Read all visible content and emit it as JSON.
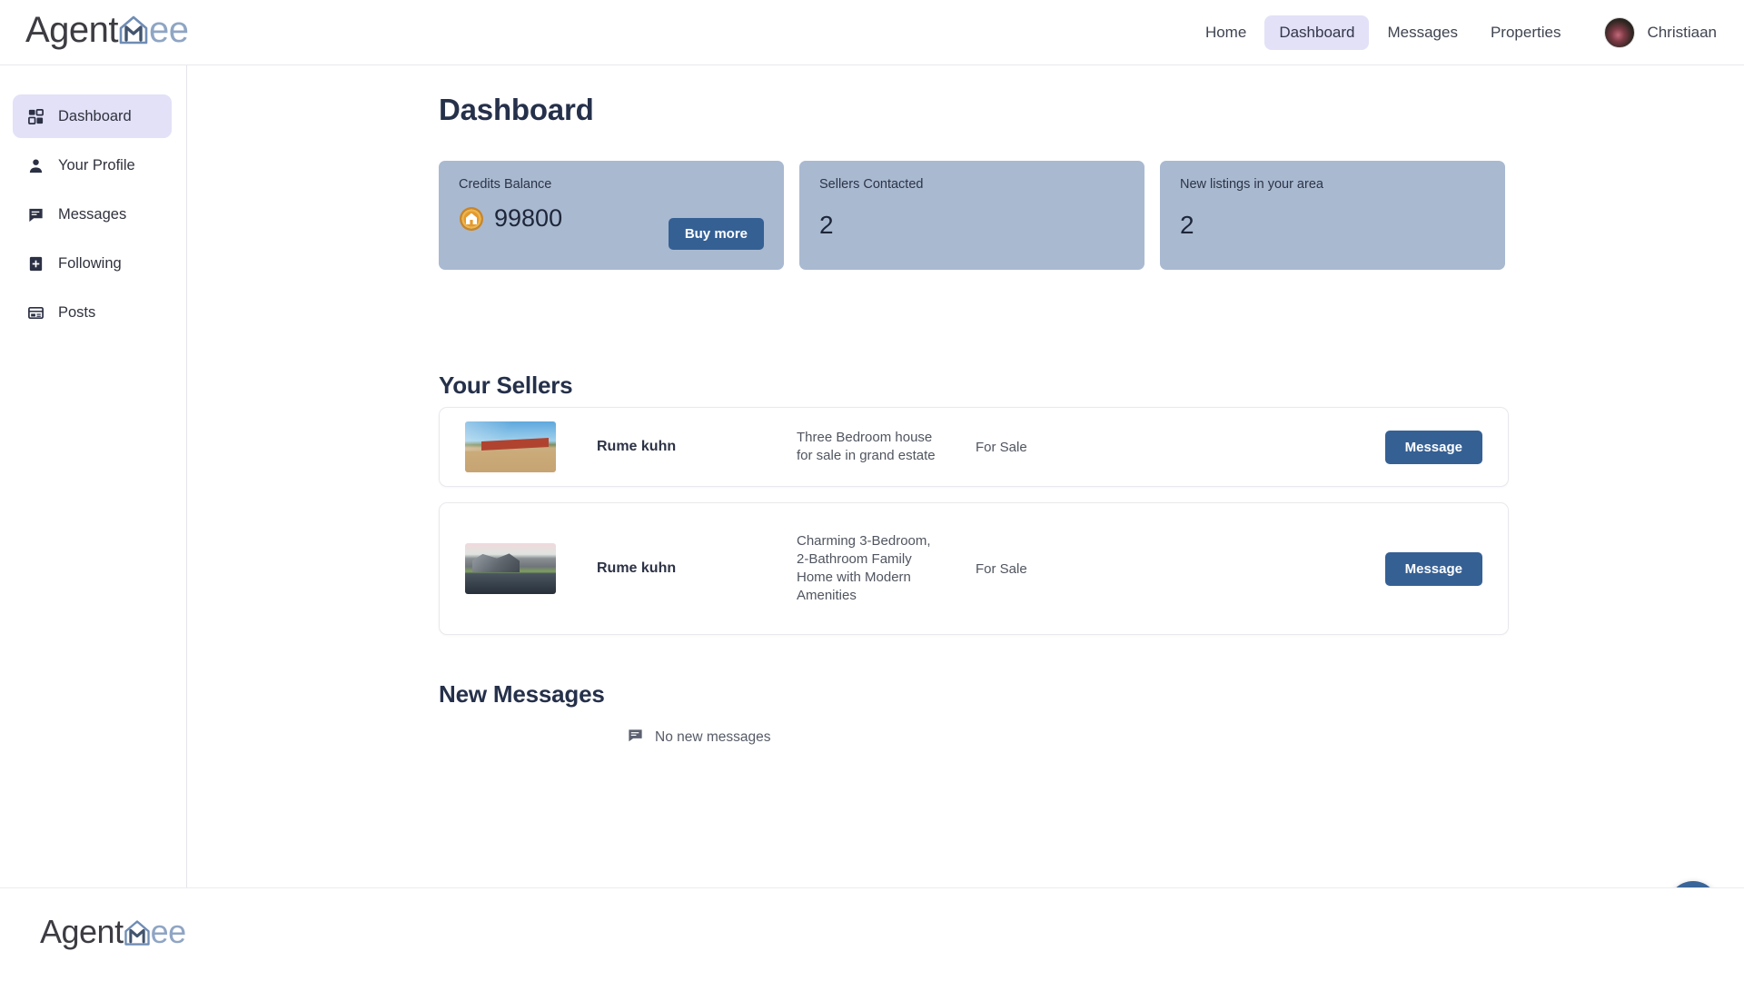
{
  "brand": {
    "prefix": "Agent",
    "mark": "house-m-logo",
    "suffix": "ee"
  },
  "topnav": {
    "links": [
      {
        "label": "Home",
        "name": "nav-home",
        "active": false
      },
      {
        "label": "Dashboard",
        "name": "nav-dashboard",
        "active": true
      },
      {
        "label": "Messages",
        "name": "nav-messages",
        "active": false
      },
      {
        "label": "Properties",
        "name": "nav-properties",
        "active": false
      }
    ],
    "user": {
      "name": "Christiaan",
      "avatar_icon": "user-avatar-photo"
    }
  },
  "sidebar": {
    "items": [
      {
        "label": "Dashboard",
        "icon": "grid-dashboard-icon",
        "active": true
      },
      {
        "label": "Your Profile",
        "icon": "person-icon",
        "active": false
      },
      {
        "label": "Messages",
        "icon": "chat-bubble-icon",
        "active": false
      },
      {
        "label": "Following",
        "icon": "bookmark-plus-icon",
        "active": false
      },
      {
        "label": "Posts",
        "icon": "article-icon",
        "active": false
      }
    ]
  },
  "main": {
    "page_title": "Dashboard",
    "cards": [
      {
        "label": "Credits Balance",
        "value": "99800",
        "icon": "gold-house-coin-icon",
        "button": "Buy more"
      },
      {
        "label": "Sellers Contacted",
        "value": "2"
      },
      {
        "label": "New listings in your area",
        "value": "2"
      }
    ],
    "sellers_title": "Your Sellers",
    "sellers": [
      {
        "thumb_icon": "property-photo-red-roof-house",
        "name": "Rume kuhn",
        "description": "Three Bedroom house for sale in grand estate",
        "status": "For Sale",
        "action": "Message"
      },
      {
        "thumb_icon": "property-photo-modern-lakehouse",
        "name": "Rume kuhn",
        "description": "Charming 3-Bedroom, 2-Bathroom Family Home with Modern Amenities",
        "status": "For Sale",
        "action": "Message"
      }
    ],
    "messages_title": "New Messages",
    "no_messages_text": "No new messages",
    "no_messages_icon": "chat-bubble-icon"
  },
  "chat_widget": {
    "icon": "chat-bubble-icon"
  },
  "colors": {
    "brand_blue": "#8fa5c4",
    "accent_button": "#356094",
    "card_bg": "#a9b9d0",
    "nav_active_bg": "#e2e1f7",
    "heading": "#25304a",
    "coin_gold": "#e8a33d"
  }
}
